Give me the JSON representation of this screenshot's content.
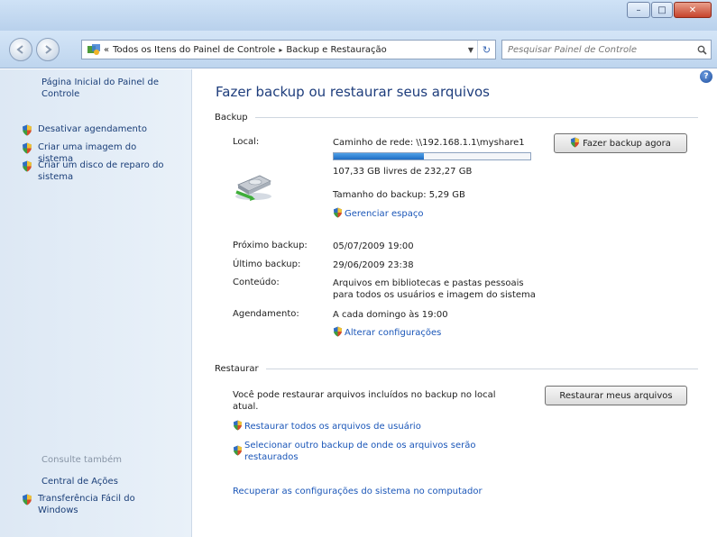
{
  "window": {
    "caption": {
      "minimize": "–",
      "maximize": "□",
      "close": "✕"
    }
  },
  "nav": {
    "back_icon": "back-arrow-icon",
    "forward_icon": "forward-arrow-icon",
    "address": {
      "overflow": "«",
      "crumbs": [
        "Todos os Itens do Painel de Controle",
        "Backup e Restauração"
      ],
      "separator": "▸"
    },
    "refresh": "↻",
    "search_placeholder": "Pesquisar Painel de Controle"
  },
  "sidebar": {
    "home": "Página Inicial do Painel de Controle",
    "tasks": [
      {
        "label": "Desativar agendamento",
        "icon": "shield-icon"
      },
      {
        "label": "Criar uma imagem do sistema",
        "icon": "shield-icon"
      },
      {
        "label": "Criar um disco de reparo do sistema",
        "icon": "shield-icon"
      }
    ],
    "see_also_heading": "Consulte também",
    "see_also": [
      {
        "label": "Central de Ações",
        "icon": ""
      },
      {
        "label": "Transferência Fácil do Windows",
        "icon": "shield-icon"
      }
    ]
  },
  "main": {
    "title": "Fazer backup ou restaurar seus arquivos",
    "backup": {
      "heading": "Backup",
      "location_label": "Local:",
      "location_value": "Caminho de rede: \\\\192.168.1.1\\myshare1",
      "disk_usage_fraction": 0.46,
      "free_space": "107,33 GB livres de 232,27 GB",
      "backup_size": "Tamanho do backup: 5,29 GB",
      "manage_space_link": "Gerenciar espaço",
      "backup_now_button": "Fazer backup agora",
      "next_backup_label": "Próximo backup:",
      "next_backup_value": "05/07/2009 19:00",
      "last_backup_label": "Último backup:",
      "last_backup_value": "29/06/2009 23:38",
      "contents_label": "Conteúdo:",
      "contents_value_line1": "Arquivos em bibliotecas e pastas pessoais",
      "contents_value_line2": "para todos os usuários e imagem do sistema",
      "schedule_label": "Agendamento:",
      "schedule_value": "A cada domingo às 19:00",
      "change_settings_link": "Alterar configurações"
    },
    "restore": {
      "heading": "Restaurar",
      "description_line1": "Você pode restaurar arquivos incluídos no backup no local",
      "description_line2": "atual.",
      "restore_button": "Restaurar meus arquivos",
      "restore_all_users_link": "Restaurar todos os arquivos de usuário",
      "select_other_line1": "Selecionar outro backup de onde os arquivos serão",
      "select_other_line2": "restaurados",
      "recover_link": "Recuperar as configurações do sistema no computador"
    }
  },
  "colors": {
    "link": "#1a56b8",
    "title": "#1e3d7c",
    "progress_fill": "#1f6cc3",
    "sidebar_bg": "#e3edf7"
  }
}
